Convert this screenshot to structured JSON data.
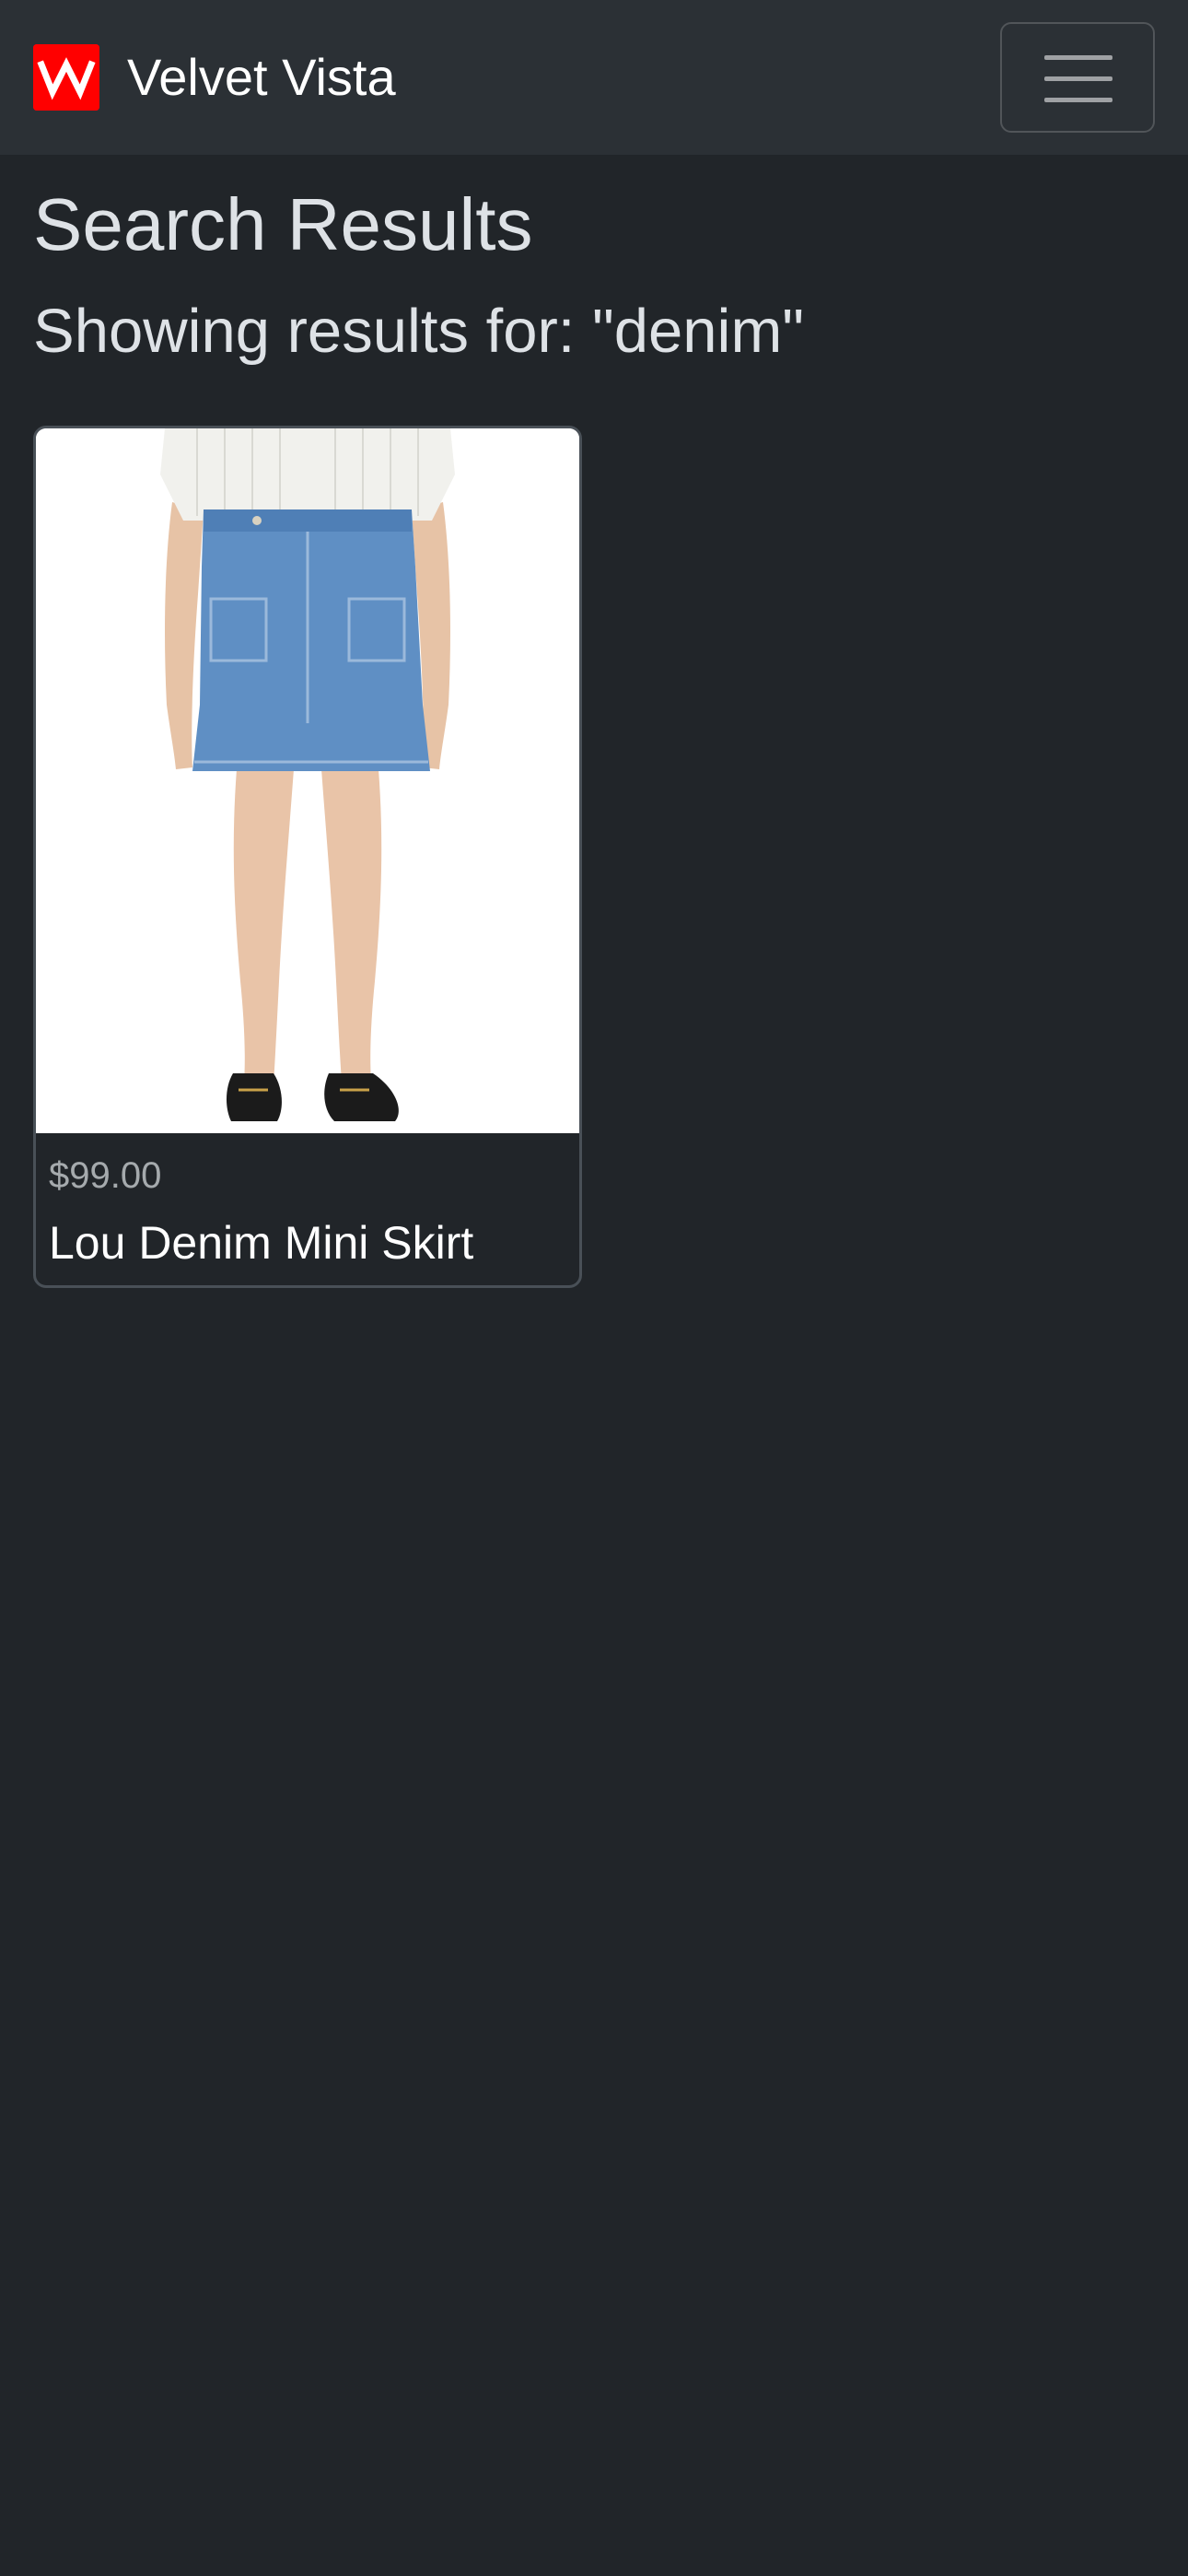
{
  "brand": {
    "name": "Velvet Vista",
    "logo_icon": "velvet-vista-logo-icon",
    "logo_color": "#ff0000"
  },
  "navbar": {
    "toggle_icon": "hamburger-menu-icon"
  },
  "page": {
    "title": "Search Results",
    "query_heading": "Showing results for: \"denim\""
  },
  "results": [
    {
      "price": "$99.00",
      "name": "Lou Denim Mini Skirt",
      "image_icon": "denim-skirt-product-photo"
    }
  ],
  "colors": {
    "background": "#212529",
    "navbar": "#2b3035",
    "text": "#dee2e6",
    "card_border": "#495057"
  }
}
